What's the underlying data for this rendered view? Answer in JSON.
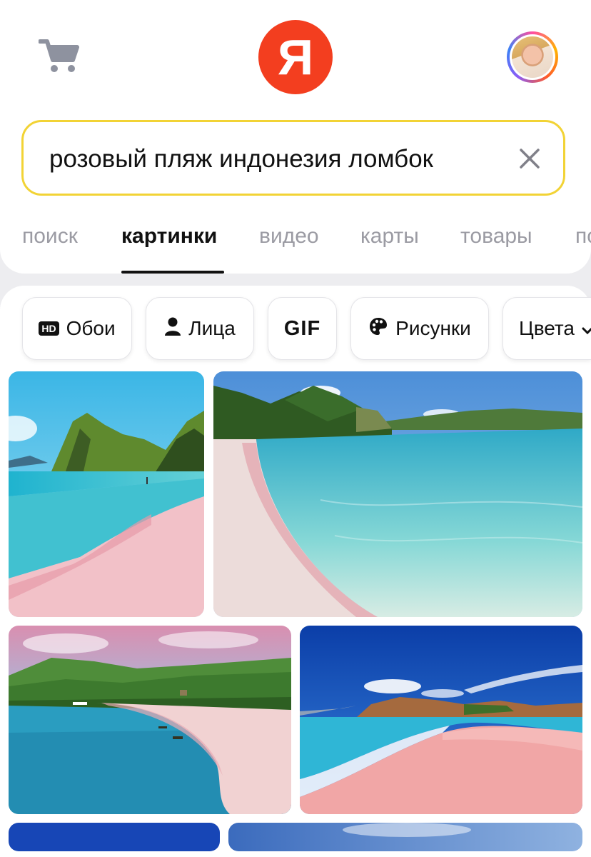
{
  "header": {
    "logo_letter": "Я",
    "cart_icon": "cart-icon",
    "avatar_icon": "user-avatar"
  },
  "search": {
    "query": "розовый пляж индонезия ломбок",
    "clear_icon": "close-icon"
  },
  "tabs": [
    {
      "label": "поиск",
      "active": false
    },
    {
      "label": "картинки",
      "active": true
    },
    {
      "label": "видео",
      "active": false
    },
    {
      "label": "карты",
      "active": false
    },
    {
      "label": "товары",
      "active": false
    },
    {
      "label": "по",
      "active": false
    }
  ],
  "filters": [
    {
      "label": "Обои",
      "badge": "HD",
      "icon": "hd-icon"
    },
    {
      "label": "Лица",
      "icon": "person-icon"
    },
    {
      "label": "GIF",
      "icon": ""
    },
    {
      "label": "Рисунки",
      "icon": "palette-icon"
    },
    {
      "label": "Цвета",
      "icon": "chevron-down-icon"
    }
  ],
  "colors": {
    "logo_red": "#f33e1f",
    "search_border": "#f2d335",
    "inactive_tab": "#9b9ba3"
  }
}
